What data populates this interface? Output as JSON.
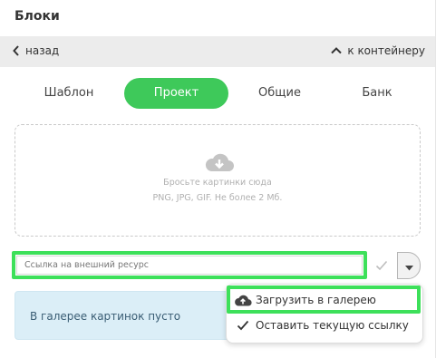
{
  "panel": {
    "title": "Блоки"
  },
  "nav": {
    "back_label": "назад",
    "up_label": "к контейнеру"
  },
  "tabs": [
    {
      "label": "Шаблон",
      "active": false
    },
    {
      "label": "Проект",
      "active": true
    },
    {
      "label": "Общие",
      "active": false
    },
    {
      "label": "Банк",
      "active": false
    }
  ],
  "dropzone": {
    "line1": "Бросьте картинки сюда",
    "line2": "PNG, JPG, GIF. Не более 2 Мб."
  },
  "url_input": {
    "placeholder": "Ссылка на внешний ресурс",
    "value": ""
  },
  "gallery": {
    "empty_text": "В галерее картинок пусто"
  },
  "menu": {
    "items": [
      {
        "label": "Загрузить в галерею",
        "icon": "cloud-upload-icon"
      },
      {
        "label": "Оставить текущую ссылку",
        "icon": "checkmark-icon"
      }
    ]
  },
  "colors": {
    "accent": "#3ec95a",
    "highlight": "#3de05a",
    "info_bg": "#dbeef7",
    "nav_bg": "#ececec"
  }
}
